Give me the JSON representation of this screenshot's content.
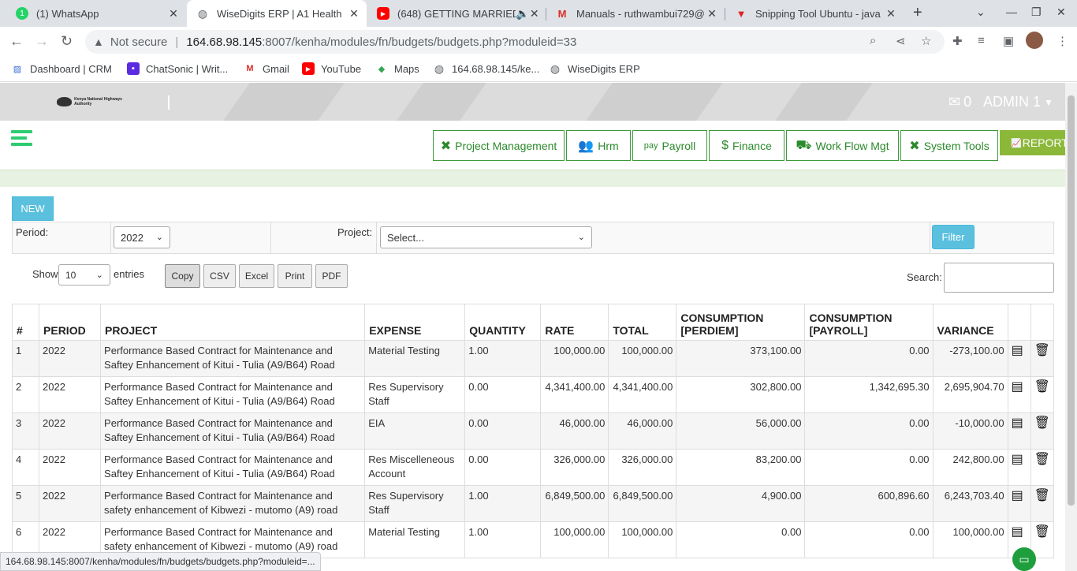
{
  "browser": {
    "tabs": [
      {
        "title": "(1) WhatsApp",
        "icon": "whatsapp-icon"
      },
      {
        "title": "WiseDigits ERP | A1 Health",
        "icon": "globe-icon"
      },
      {
        "title": "(648) GETTING MARRIED",
        "icon": "youtube-icon"
      },
      {
        "title": "Manuals - ruthwambui729@",
        "icon": "gmail-icon"
      },
      {
        "title": "Snipping Tool Ubuntu - java",
        "icon": "vivaldi-icon"
      }
    ],
    "omnibox": {
      "security": "Not secure",
      "host": "164.68.98.145",
      "path": ":8007/kenha/modules/fn/budgets/budgets.php?moduleid=33"
    },
    "bookmarks": [
      "Dashboard | CRM",
      "ChatSonic | Writ...",
      "Gmail",
      "YouTube",
      "Maps",
      "164.68.98.145/ke...",
      "WiseDigits ERP"
    ],
    "status_url": "164.68.98.145:8007/kenha/modules/fn/budgets/budgets.php?moduleid=..."
  },
  "header": {
    "logo_text": "Kenya National Highways Authority",
    "messages_count": "0",
    "user": "ADMIN 1"
  },
  "modules": [
    "Project Management",
    "Hrm",
    "Payroll",
    "Finance",
    "Work Flow Mgt",
    "System Tools"
  ],
  "reports_label": "REPORTS",
  "payroll_icon_text": "pay",
  "new_label": "NEW",
  "filters": {
    "period_label": "Period:",
    "period_value": "2022",
    "project_label": "Project:",
    "project_value": "Select...",
    "filter_label": "Filter"
  },
  "table_controls": {
    "show_label": "Show",
    "entries_value": "10",
    "entries_label": "entries",
    "buttons": [
      "Copy",
      "CSV",
      "Excel",
      "Print",
      "PDF"
    ],
    "search_label": "Search:"
  },
  "table": {
    "headers": [
      "#",
      "PERIOD",
      "PROJECT",
      "EXPENSE",
      "QUANTITY",
      "RATE",
      "TOTAL",
      "CONSUMPTION [PERDIEM]",
      "CONSUMPTION [PAYROLL]",
      "VARIANCE"
    ],
    "rows": [
      {
        "no": "1",
        "period": "2022",
        "project": "Performance Based Contract for Maintenance and Saftey Enhancement of Kitui - Tulia (A9/B64) Road",
        "expense": "Material Testing",
        "quantity": "1.00",
        "rate": "100,000.00",
        "total": "100,000.00",
        "perdiem": "373,100.00",
        "payroll": "0.00",
        "variance": "-273,100.00"
      },
      {
        "no": "2",
        "period": "2022",
        "project": "Performance Based Contract for Maintenance and Saftey Enhancement of Kitui - Tulia (A9/B64) Road",
        "expense": "Res Supervisory Staff",
        "quantity": "0.00",
        "rate": "4,341,400.00",
        "total": "4,341,400.00",
        "perdiem": "302,800.00",
        "payroll": "1,342,695.30",
        "variance": "2,695,904.70"
      },
      {
        "no": "3",
        "period": "2022",
        "project": "Performance Based Contract for Maintenance and Saftey Enhancement of Kitui - Tulia (A9/B64) Road",
        "expense": "EIA",
        "quantity": "0.00",
        "rate": "46,000.00",
        "total": "46,000.00",
        "perdiem": "56,000.00",
        "payroll": "0.00",
        "variance": "-10,000.00"
      },
      {
        "no": "4",
        "period": "2022",
        "project": "Performance Based Contract for Maintenance and Saftey Enhancement of Kitui - Tulia (A9/B64) Road",
        "expense": "Res Miscelleneous Account",
        "quantity": "0.00",
        "rate": "326,000.00",
        "total": "326,000.00",
        "perdiem": "83,200.00",
        "payroll": "0.00",
        "variance": "242,800.00"
      },
      {
        "no": "5",
        "period": "2022",
        "project": "Performance Based Contract for Maintenance and safety enhancement of Kibwezi - mutomo (A9) road",
        "expense": "Res Supervisory Staff",
        "quantity": "1.00",
        "rate": "6,849,500.00",
        "total": "6,849,500.00",
        "perdiem": "4,900.00",
        "payroll": "600,896.60",
        "variance": "6,243,703.40"
      },
      {
        "no": "6",
        "period": "2022",
        "project": "Performance Based Contract for Maintenance and safety enhancement of Kibwezi - mutomo (A9) road",
        "expense": "Material Testing",
        "quantity": "1.00",
        "rate": "100,000.00",
        "total": "100,000.00",
        "perdiem": "0.00",
        "payroll": "0.00",
        "variance": "100,000.00"
      }
    ]
  },
  "colors": {
    "accent_green": "#2b8a2b",
    "reports_bg": "#8cb83a",
    "info_blue": "#5bc0de",
    "header_gray": "#dcdcdc"
  }
}
